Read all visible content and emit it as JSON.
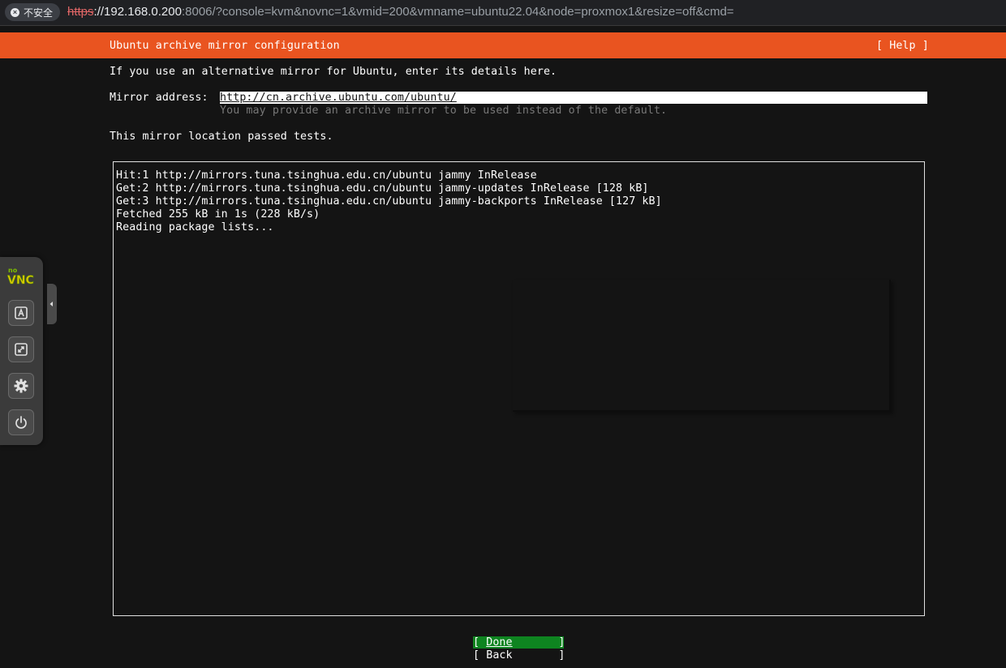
{
  "browser": {
    "security_label": "不安全",
    "url_scheme": "https",
    "url_host": "://192.168.0.200",
    "url_rest": ":8006/?console=kvm&novnc=1&vmid=200&vmname=ubuntu22.04&node=proxmox1&resize=off&cmd="
  },
  "installer": {
    "title": "Ubuntu archive mirror configuration",
    "help_label": "[ Help ]",
    "intro": "If you use an alternative mirror for Ubuntu, enter its details here.",
    "mirror_label": "Mirror address:",
    "mirror_value": "http://cn.archive.ubuntu.com/ubuntu/",
    "mirror_hint": "You may provide an archive mirror to be used instead of the default.",
    "status": "This mirror location passed tests.",
    "log_lines": [
      "Hit:1 http://mirrors.tuna.tsinghua.edu.cn/ubuntu jammy InRelease",
      "Get:2 http://mirrors.tuna.tsinghua.edu.cn/ubuntu jammy-updates InRelease [128 kB]",
      "Get:3 http://mirrors.tuna.tsinghua.edu.cn/ubuntu jammy-backports InRelease [127 kB]",
      "Fetched 255 kB in 1s (228 kB/s)",
      "Reading package lists..."
    ],
    "done_open": "[ ",
    "done_label": "Done",
    "done_close": "       ]",
    "back_open": "[ ",
    "back_label": "Back",
    "back_close": "       ]"
  },
  "novnc": {
    "logo_top": "no",
    "logo_main": "VNC",
    "icons": [
      "keyboard-icon",
      "fullscreen-icon",
      "settings-icon",
      "power-icon"
    ],
    "accent": "#e95420",
    "focus_green": "#0e8420"
  }
}
